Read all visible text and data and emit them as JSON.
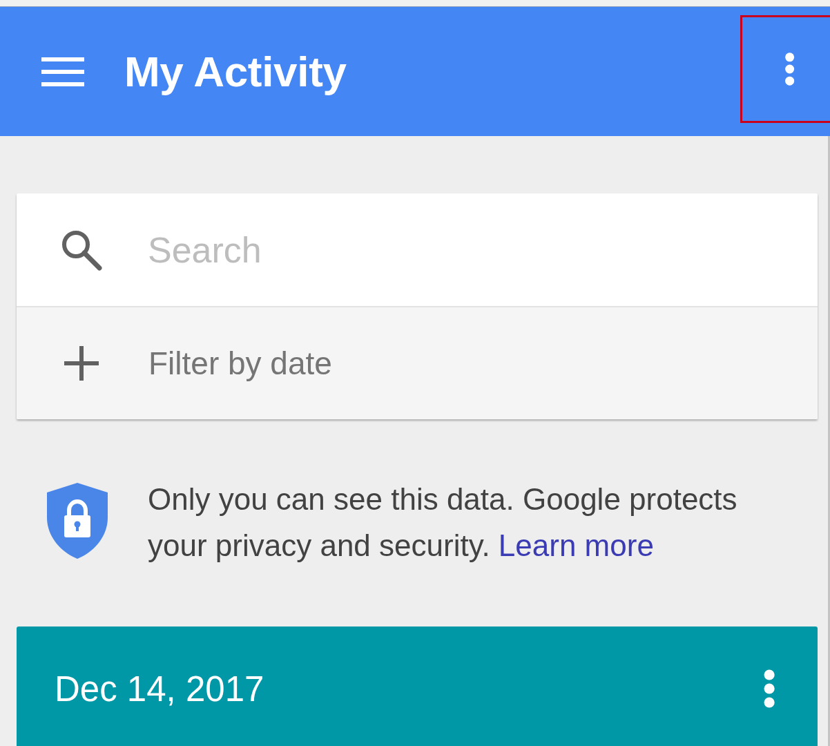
{
  "app_bar": {
    "title": "My Activity",
    "menu_highlighted": true
  },
  "search": {
    "placeholder": "Search"
  },
  "filter": {
    "label": "Filter by date"
  },
  "privacy_notice": {
    "text": "Only you can see this data. Google protects your privacy and security.",
    "link": "Learn more"
  },
  "day_card": {
    "date": "Dec 14, 2017"
  }
}
